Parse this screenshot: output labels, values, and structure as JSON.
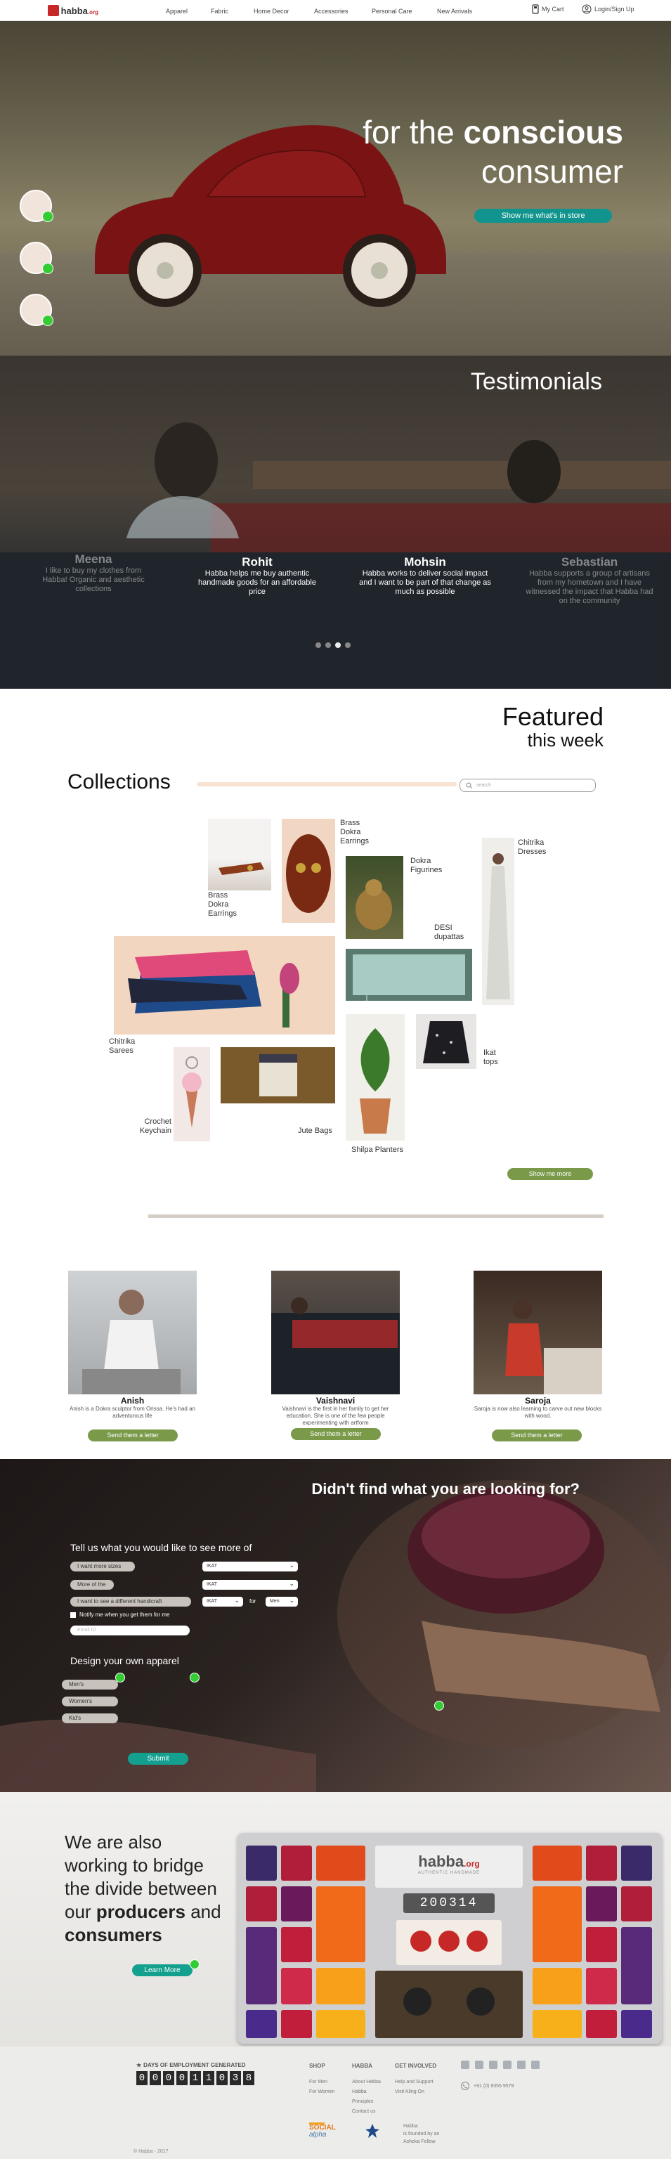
{
  "header": {
    "logo_text": "habba",
    "logo_suffix": ".org",
    "nav": [
      "Apparel",
      "Fabric",
      "Home Decor",
      "Accessories",
      "Personal Care",
      "New Arrivals"
    ],
    "cart_label": "My Cart",
    "login_label": "Login/Sign Up"
  },
  "hero": {
    "line1_plain": "for the ",
    "line1_bold": "conscious",
    "line2": "consumer",
    "button": "Show me what's in store"
  },
  "testimonials": {
    "title": "Testimonials",
    "items": [
      {
        "name": "Meena",
        "quote": "I like to buy my clothes from Habba! Organic and aesthetic collections"
      },
      {
        "name": "Rohit",
        "quote": "Habba helps me buy authentic handmade goods for an affordable price"
      },
      {
        "name": "Mohsin",
        "quote": "Habba works to deliver social impact and I want to be part of that change as much as possible"
      },
      {
        "name": "Sebastian",
        "quote": "Habba supports a group of artisans from my hometown and I have witnessed the impact that Habba had on the community"
      }
    ]
  },
  "featured": {
    "title": "Featured",
    "subtitle": "this week",
    "collections_title": "Collections",
    "search_placeholder": "search",
    "items": {
      "brass1": "Brass Dokra Earrings",
      "brass2": "Brass Dokra Earrings",
      "dokra": "Dokra Figurines",
      "chitrika_dresses": "Chitrika Dresses",
      "desi": "DESI dupattas",
      "chitrika_sarees": "Chitrika Sarees",
      "ikat": "Ikat tops",
      "crochet": "Crochet Keychain",
      "jute": "Jute Bags",
      "shilpa": "Shilpa Planters"
    },
    "show_more": "Show me more"
  },
  "artisans": [
    {
      "name": "Anish",
      "desc": "Anish is a Dokra sculptor from Orissa. He's had an adventurous life",
      "button": "Send them a letter"
    },
    {
      "name": "Vaishnavi",
      "desc": "Vaishnavi is the first in her family to get her education. She is one of the few people experimenting with artform",
      "button": "Send them a letter"
    },
    {
      "name": "Saroja",
      "desc": "Saroja is now also learning to carve out new blocks with wood.",
      "button": "Send them a letter"
    }
  ],
  "request_form": {
    "title": "Didn't find what you are looking for?",
    "tell_us": "Tell us what you would like to see more of",
    "options": [
      "I want more sizes",
      "More of the",
      "I want to see a different handicraft"
    ],
    "select_values": [
      "IKAT",
      "IKAT",
      "IKAT",
      "Men"
    ],
    "for_label": "for",
    "notify_label": "Notify me when you get them for me",
    "email_placeholder": "Email ID",
    "design_title": "Design your own apparel",
    "design_options": [
      "Men's",
      "Women's",
      "Kid's"
    ],
    "submit": "Submit"
  },
  "bridge": {
    "l1": "We are also",
    "l2": "working to bridge",
    "l3": "the divide between",
    "l4_plain1": "our ",
    "l4_bold": "producers",
    "l4_plain2": " and",
    "l5_bold": "consumers",
    "button": "Learn More",
    "box_brand": "habba",
    "box_brand_suffix": ".org",
    "box_tagline": "AUTHENTIC HANDMADE",
    "box_counter": "200314"
  },
  "footer": {
    "counter_label": "DAYS OF EMPLOYMENT GENERATED",
    "counter_digits": [
      "0",
      "0",
      "0",
      "0",
      "1",
      "1",
      "0",
      "3",
      "8"
    ],
    "shop_head": "SHOP",
    "shop_links": [
      "For Men",
      "For Women"
    ],
    "habba_head": "HABBA",
    "habba_links": [
      "About Habba",
      "Habba",
      "Principles",
      "Contact us"
    ],
    "involved_head": "GET INVOLVED",
    "involved_links": [
      "Help and Support",
      "Visit Kling On"
    ],
    "phone": "+91 (0) 9355 9579",
    "social_alpha": "SOCIAL",
    "social_alpha2": "alpha",
    "founded_1": "Habba",
    "founded_2": "is founded by an",
    "founded_3": "Ashoka Fellow",
    "copyright": "© Habba - 2017"
  }
}
